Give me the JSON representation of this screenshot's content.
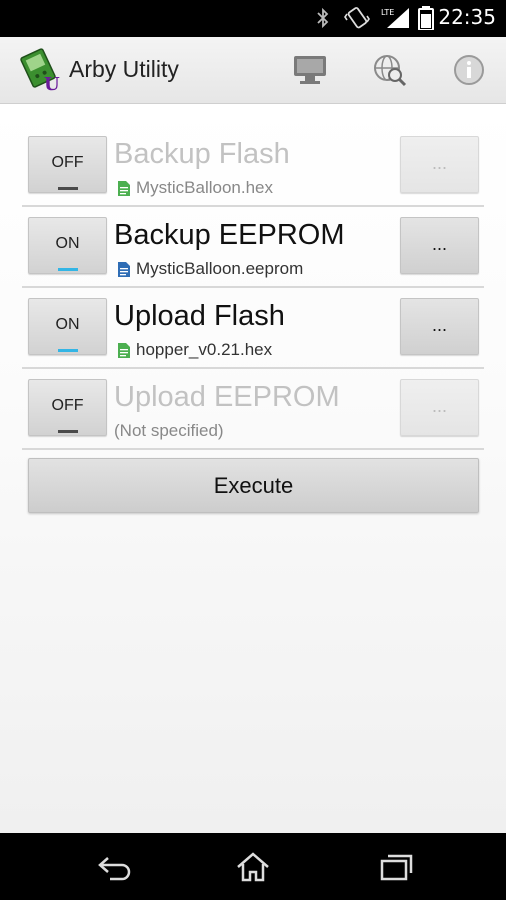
{
  "status_bar": {
    "time": "22:35",
    "icons": [
      "bluetooth-icon",
      "vibrate-icon",
      "lte-signal-icon",
      "battery-icon"
    ],
    "network_label": "LTE"
  },
  "app_bar": {
    "title": "Arby Utility",
    "logo_letter": "U",
    "actions": [
      "monitor-icon",
      "web-search-icon",
      "info-icon"
    ]
  },
  "rows": [
    {
      "toggle": "OFF",
      "state": "off",
      "title": "Backup Flash",
      "file": "MysticBalloon.hex",
      "file_icon": "hex-file-icon",
      "file_color": "#4caf50",
      "browse": "...",
      "enabled": false
    },
    {
      "toggle": "ON",
      "state": "on",
      "title": "Backup EEPROM",
      "file": "MysticBalloon.eeprom",
      "file_icon": "eeprom-file-icon",
      "file_color": "#2f6db5",
      "browse": "...",
      "enabled": true
    },
    {
      "toggle": "ON",
      "state": "on",
      "title": "Upload Flash",
      "file": "hopper_v0.21.hex",
      "file_icon": "hex-file-icon",
      "file_color": "#4caf50",
      "browse": "...",
      "enabled": true
    },
    {
      "toggle": "OFF",
      "state": "off",
      "title": "Upload EEPROM",
      "file": "(Not specified)",
      "file_icon": "",
      "file_color": "",
      "browse": "...",
      "enabled": false
    }
  ],
  "execute_label": "Execute",
  "colors": {
    "accent": "#33b5e5",
    "action_bar": "#eeeeee",
    "logo_letter": "#6a1b9a"
  },
  "nav_bar": [
    "back-icon",
    "home-icon",
    "recent-apps-icon"
  ]
}
